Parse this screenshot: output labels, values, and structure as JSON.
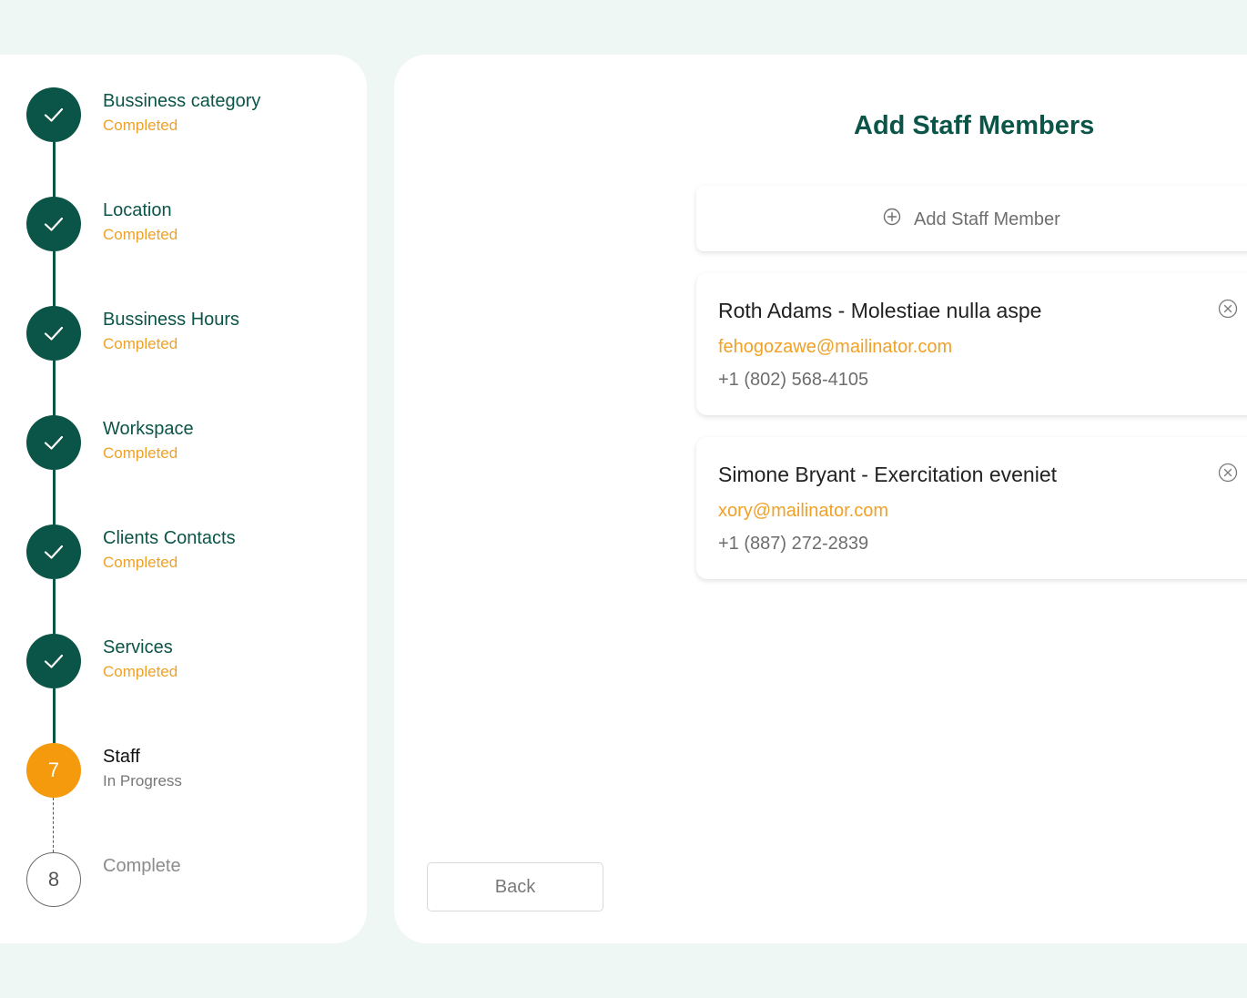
{
  "stepper": {
    "steps": [
      {
        "title": "Bussiness category",
        "status": "Completed"
      },
      {
        "title": "Location",
        "status": "Completed"
      },
      {
        "title": "Bussiness Hours",
        "status": "Completed"
      },
      {
        "title": "Workspace",
        "status": "Completed"
      },
      {
        "title": "Clients Contacts",
        "status": "Completed"
      },
      {
        "title": "Services",
        "status": "Completed"
      },
      {
        "number": "7",
        "title": "Staff",
        "status": "In Progress"
      },
      {
        "number": "8",
        "title": "Complete"
      }
    ]
  },
  "main": {
    "title": "Add Staff Members",
    "add_button_label": "Add Staff Member",
    "staff": [
      {
        "name": "Roth Adams - Molestiae nulla aspe",
        "email": "fehogozawe@mailinator.com",
        "phone": "+1 (802) 568-4105"
      },
      {
        "name": "Simone Bryant - Exercitation eveniet",
        "email": "xory@mailinator.com",
        "phone": "+1 (887) 272-2839"
      }
    ],
    "back_label": "Back"
  },
  "colors": {
    "primary": "#0b5448",
    "accent": "#f49a0c",
    "background": "#eff7f5"
  }
}
